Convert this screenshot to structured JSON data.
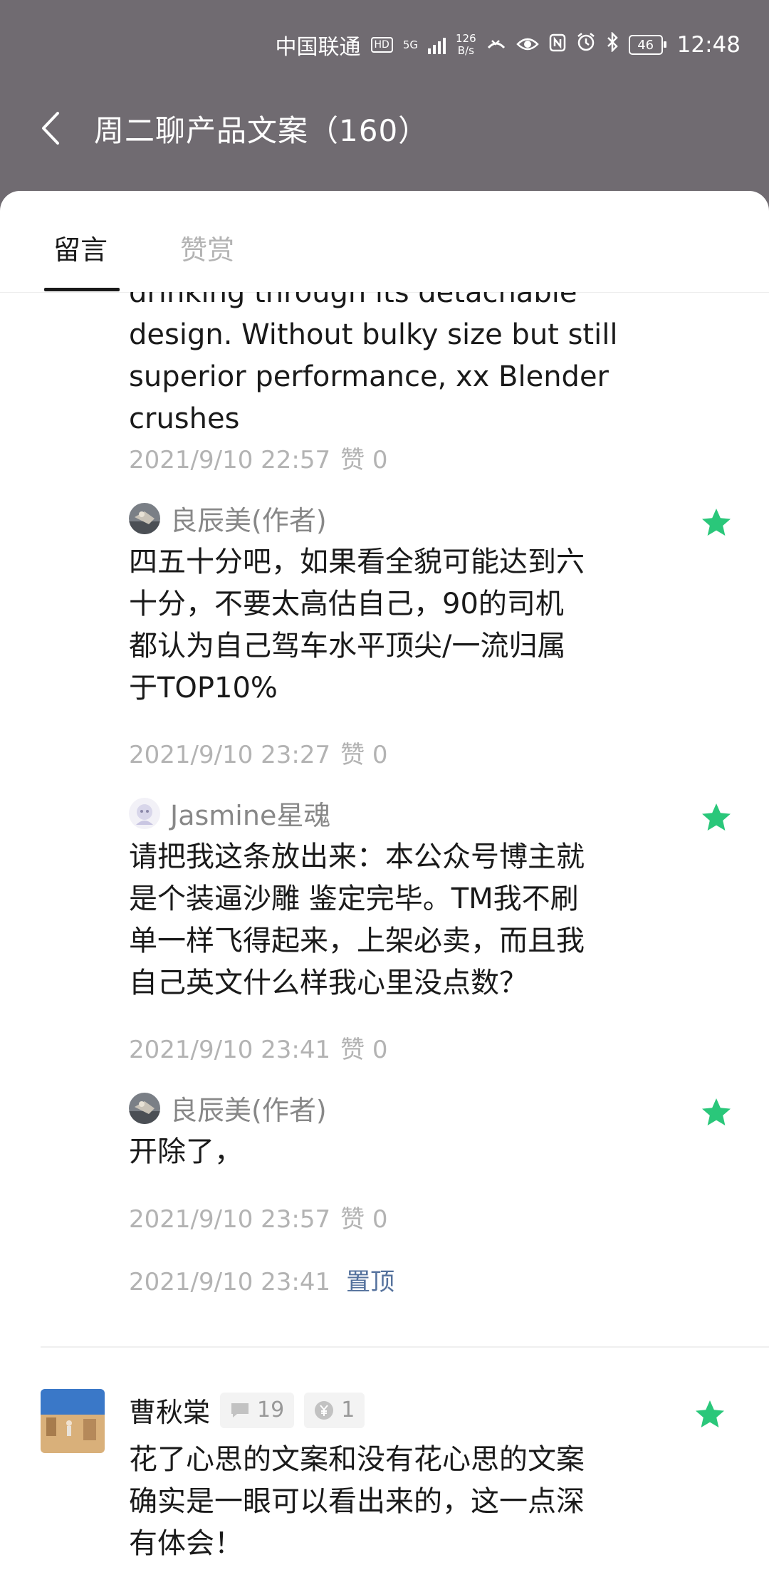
{
  "status_bar": {
    "carrier": "中国联通",
    "hd": "HD",
    "net_top": "5G",
    "speed_value": "126",
    "speed_unit": "B/s",
    "battery": "46",
    "time": "12:48"
  },
  "nav": {
    "title": "周二聊产品文案（160）"
  },
  "tabs": [
    {
      "label": "留言",
      "active": true
    },
    {
      "label": "赞赏",
      "active": false
    }
  ],
  "thread": {
    "partial_reply": {
      "text_lines": [
        "drinking through its detachable",
        "design. Without bulky size but still",
        "superior performance, xx Blender",
        "crushes"
      ],
      "time": "2021/9/10 22:57",
      "likes": "赞 0"
    },
    "replies": [
      {
        "author": "良辰美(作者)",
        "text_lines": [
          "四五十分吧，如果看全貌可能达到六",
          "十分，不要太高估自己，90的司机",
          "都认为自己驾车水平顶尖/一流归属",
          "于TOP10%"
        ],
        "time": "2021/9/10 23:27",
        "likes": "赞 0"
      },
      {
        "author": "Jasmine星魂",
        "text_lines": [
          "请把我这条放出来：本公众号博主就",
          "是个装逼沙雕 鉴定完毕。TM我不刷",
          "单一样飞得起来，上架必卖，而且我",
          "自己英文什么样我心里没点数？"
        ],
        "time": "2021/9/10 23:41",
        "likes": "赞 0"
      },
      {
        "author": "良辰美(作者)",
        "text_lines": [
          "开除了，"
        ],
        "time": "2021/9/10 23:57",
        "likes": "赞 0"
      }
    ],
    "footer_time": "2021/9/10 23:41",
    "pin_label": "置顶"
  },
  "next_comment": {
    "author": "曹秋棠",
    "comment_count": "19",
    "reward_count": "1",
    "text_lines": [
      "花了心思的文案和没有花心思的文案",
      "确实是一眼可以看出来的，这一点深",
      "有体会！"
    ]
  },
  "colors": {
    "header_bg": "#706b71",
    "star_green": "#2ac77a",
    "link_blue": "#55729d",
    "muted_text": "#b3b3b3"
  },
  "icons": [
    "back-arrow-icon",
    "star-icon",
    "comment-icon",
    "yuan-icon"
  ]
}
